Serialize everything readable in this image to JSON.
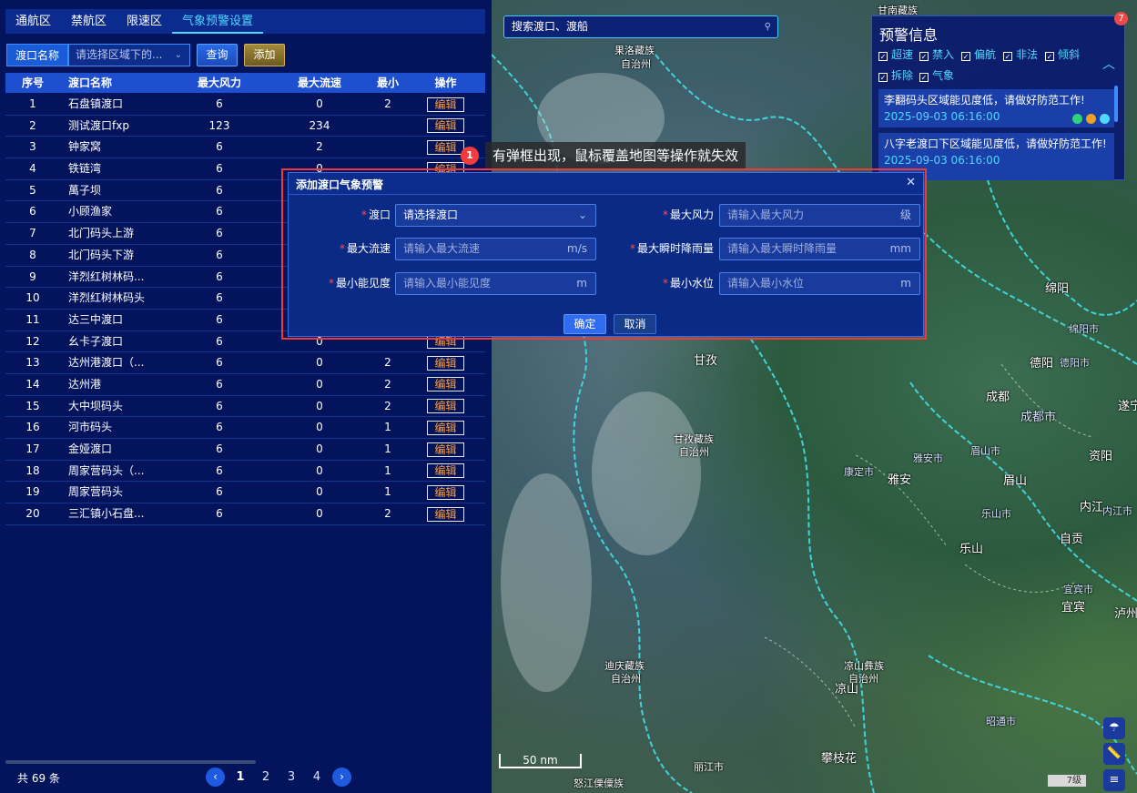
{
  "tabs": [
    "通航区",
    "禁航区",
    "限速区",
    "气象预警设置"
  ],
  "active_tab": 3,
  "filter": {
    "label": "渡口名称",
    "select_placeholder": "请选择区域下的...",
    "query_label": "查询",
    "add_label": "添加"
  },
  "table": {
    "headers": [
      "序号",
      "渡口名称",
      "最大风力",
      "最大流速",
      "最小",
      "操作"
    ],
    "edit_label": "编辑",
    "rows": [
      {
        "no": "1",
        "name": "石盘镇渡口",
        "wind": "6",
        "flow": "0",
        "min": "2"
      },
      {
        "no": "2",
        "name": "测试渡口fxp",
        "wind": "123",
        "flow": "234",
        "min": ""
      },
      {
        "no": "3",
        "name": "钟家窝",
        "wind": "6",
        "flow": "2",
        "min": ""
      },
      {
        "no": "4",
        "name": "铁链湾",
        "wind": "6",
        "flow": "0",
        "min": ""
      },
      {
        "no": "5",
        "name": "萬子坝",
        "wind": "6",
        "flow": "",
        "min": ""
      },
      {
        "no": "6",
        "name": "小顾渔家",
        "wind": "6",
        "flow": "",
        "min": ""
      },
      {
        "no": "7",
        "name": "北门码头上游",
        "wind": "6",
        "flow": "",
        "min": ""
      },
      {
        "no": "8",
        "name": "北门码头下游",
        "wind": "6",
        "flow": "",
        "min": ""
      },
      {
        "no": "9",
        "name": "洋烈红树林码...",
        "wind": "6",
        "flow": "",
        "min": ""
      },
      {
        "no": "10",
        "name": "洋烈红树林码头",
        "wind": "6",
        "flow": "",
        "min": ""
      },
      {
        "no": "11",
        "name": "达三中渡口",
        "wind": "6",
        "flow": "",
        "min": ""
      },
      {
        "no": "12",
        "name": "幺卡子渡口",
        "wind": "6",
        "flow": "0",
        "min": ""
      },
      {
        "no": "13",
        "name": "达州港渡口（...",
        "wind": "6",
        "flow": "0",
        "min": "2"
      },
      {
        "no": "14",
        "name": "达州港",
        "wind": "6",
        "flow": "0",
        "min": "2"
      },
      {
        "no": "15",
        "name": "大中坝码头",
        "wind": "6",
        "flow": "0",
        "min": "2"
      },
      {
        "no": "16",
        "name": "河市码头",
        "wind": "6",
        "flow": "0",
        "min": "1"
      },
      {
        "no": "17",
        "name": "金娅渡口",
        "wind": "6",
        "flow": "0",
        "min": "1"
      },
      {
        "no": "18",
        "name": "周家营码头（...",
        "wind": "6",
        "flow": "0",
        "min": "1"
      },
      {
        "no": "19",
        "name": "周家营码头",
        "wind": "6",
        "flow": "0",
        "min": "1"
      },
      {
        "no": "20",
        "name": "三汇镇小石盘...",
        "wind": "6",
        "flow": "0",
        "min": "2"
      }
    ]
  },
  "footer": {
    "total": "共 69 条",
    "prev_icon": "chevron-left-icon",
    "next_icon": "chevron-right-icon",
    "pages": [
      "1",
      "2",
      "3",
      "4"
    ],
    "active_page": "1"
  },
  "map": {
    "search_placeholder": "搜索渡口、渡船",
    "scale": "50 nm",
    "zoom_level": "7级",
    "labels": [
      "甘南藏族",
      "果洛藏族",
      "自治州",
      "甘孜",
      "甘孜藏族",
      "自治州",
      "康定市",
      "雅安",
      "雅安市",
      "成都",
      "成都市",
      "德阳",
      "德阳市",
      "绵阳",
      "绵阳市",
      "遂宁",
      "资阳",
      "眉山",
      "眉山市",
      "内江",
      "内江市",
      "乐山",
      "乐山市",
      "自贡",
      "宜宾",
      "宜宾市",
      "泸州",
      "凉山彝族",
      "自治州",
      "凉山",
      "迪庆藏族",
      "自治州",
      "丽江市",
      "怒江傈僳族",
      "攀枝花",
      "昭通市"
    ]
  },
  "warning_panel": {
    "title": "预警信息",
    "badge": "7",
    "filters": [
      "超速",
      "禁入",
      "偏航",
      "非法",
      "倾斜",
      "拆除",
      "气象"
    ],
    "cards": [
      {
        "text": "李翻码头区域能见度低，请做好防范工作!",
        "time": "2025-09-03 06:16:00"
      },
      {
        "text": "八字老渡口下区域能见度低，请做好防范工作!",
        "time": "2025-09-03 06:16:00"
      }
    ]
  },
  "tooltip": {
    "number": "1",
    "text": "有弹框出现，鼠标覆盖地图等操作就失效"
  },
  "modal": {
    "title": "添加渡口气象预警",
    "fields": {
      "ferry": {
        "label": "渡口",
        "value": "请选择渡口"
      },
      "max_wind": {
        "label": "最大风力",
        "placeholder": "请输入最大风力",
        "unit": "级"
      },
      "max_flow": {
        "label": "最大流速",
        "placeholder": "请输入最大流速",
        "unit": "m/s"
      },
      "max_rain": {
        "label": "最大瞬时降雨量",
        "placeholder": "请输入最大瞬时降雨量",
        "unit": "mm"
      },
      "min_visibility": {
        "label": "最小能见度",
        "placeholder": "请输入最小能见度",
        "unit": "m"
      },
      "min_water": {
        "label": "最小水位",
        "placeholder": "请输入最小水位",
        "unit": "m"
      }
    },
    "ok_label": "确定",
    "cancel_label": "取消"
  },
  "colors": {
    "panel_bg": "#04145c",
    "accent": "#4fd8ff",
    "edit_orange": "#ff9b2e",
    "highlight_red": "#f03838"
  }
}
